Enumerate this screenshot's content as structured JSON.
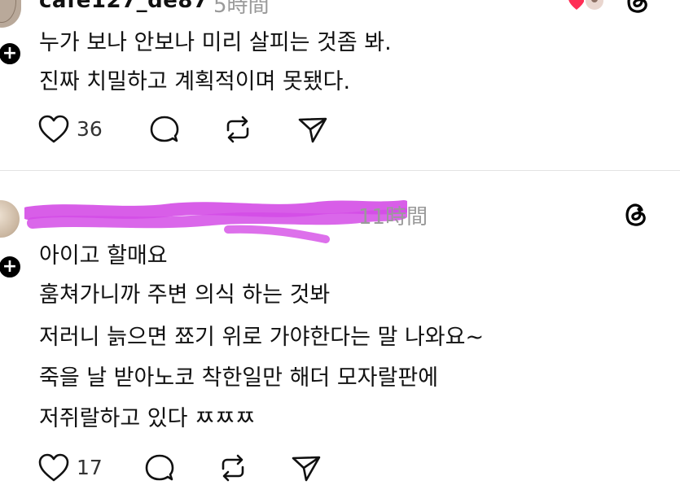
{
  "posts": [
    {
      "username": "cafe127_de87",
      "time": "5時間",
      "lines": [
        "누가 보나 안보나 미리 살피는 것좀 봐.",
        "진짜 치밀하고 계획적이며 못됐다."
      ],
      "likes": "36"
    },
    {
      "time": "11時間",
      "lines": [
        "아이고 할매요",
        "훔쳐가니까 주변 의식 하는 것봐",
        "저러니 늙으면 쬬기 위로 가야한다는 말 나와요~",
        "죽을 날 받아노코 착한일만 해더 모자랄판에",
        "저쥐랄하고 있다 ㅉㅉㅉ"
      ],
      "likes": "17"
    }
  ],
  "icons": {
    "like": "heart-icon",
    "reply": "comment-icon",
    "repost": "repost-icon",
    "share": "send-icon",
    "app": "threads-logo-icon",
    "follow": "plus-icon"
  },
  "colors": {
    "scribble": "#d44ce6",
    "reaction_heart": "#ff2d55",
    "muted_text": "#9a9a9a"
  }
}
